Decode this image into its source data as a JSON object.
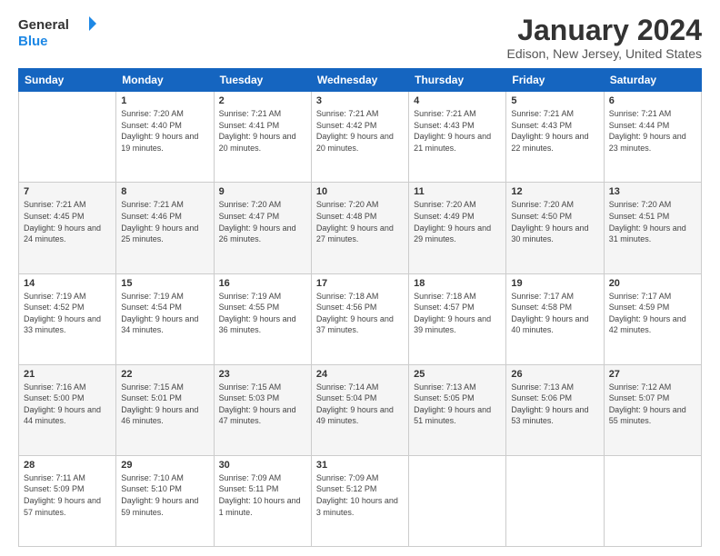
{
  "logo": {
    "line1": "General",
    "line2": "Blue"
  },
  "title": "January 2024",
  "location": "Edison, New Jersey, United States",
  "days_of_week": [
    "Sunday",
    "Monday",
    "Tuesday",
    "Wednesday",
    "Thursday",
    "Friday",
    "Saturday"
  ],
  "weeks": [
    [
      {
        "day": "",
        "sunrise": "",
        "sunset": "",
        "daylight": ""
      },
      {
        "day": "1",
        "sunrise": "Sunrise: 7:20 AM",
        "sunset": "Sunset: 4:40 PM",
        "daylight": "Daylight: 9 hours and 19 minutes."
      },
      {
        "day": "2",
        "sunrise": "Sunrise: 7:21 AM",
        "sunset": "Sunset: 4:41 PM",
        "daylight": "Daylight: 9 hours and 20 minutes."
      },
      {
        "day": "3",
        "sunrise": "Sunrise: 7:21 AM",
        "sunset": "Sunset: 4:42 PM",
        "daylight": "Daylight: 9 hours and 20 minutes."
      },
      {
        "day": "4",
        "sunrise": "Sunrise: 7:21 AM",
        "sunset": "Sunset: 4:43 PM",
        "daylight": "Daylight: 9 hours and 21 minutes."
      },
      {
        "day": "5",
        "sunrise": "Sunrise: 7:21 AM",
        "sunset": "Sunset: 4:43 PM",
        "daylight": "Daylight: 9 hours and 22 minutes."
      },
      {
        "day": "6",
        "sunrise": "Sunrise: 7:21 AM",
        "sunset": "Sunset: 4:44 PM",
        "daylight": "Daylight: 9 hours and 23 minutes."
      }
    ],
    [
      {
        "day": "7",
        "sunrise": "Sunrise: 7:21 AM",
        "sunset": "Sunset: 4:45 PM",
        "daylight": "Daylight: 9 hours and 24 minutes."
      },
      {
        "day": "8",
        "sunrise": "Sunrise: 7:21 AM",
        "sunset": "Sunset: 4:46 PM",
        "daylight": "Daylight: 9 hours and 25 minutes."
      },
      {
        "day": "9",
        "sunrise": "Sunrise: 7:20 AM",
        "sunset": "Sunset: 4:47 PM",
        "daylight": "Daylight: 9 hours and 26 minutes."
      },
      {
        "day": "10",
        "sunrise": "Sunrise: 7:20 AM",
        "sunset": "Sunset: 4:48 PM",
        "daylight": "Daylight: 9 hours and 27 minutes."
      },
      {
        "day": "11",
        "sunrise": "Sunrise: 7:20 AM",
        "sunset": "Sunset: 4:49 PM",
        "daylight": "Daylight: 9 hours and 29 minutes."
      },
      {
        "day": "12",
        "sunrise": "Sunrise: 7:20 AM",
        "sunset": "Sunset: 4:50 PM",
        "daylight": "Daylight: 9 hours and 30 minutes."
      },
      {
        "day": "13",
        "sunrise": "Sunrise: 7:20 AM",
        "sunset": "Sunset: 4:51 PM",
        "daylight": "Daylight: 9 hours and 31 minutes."
      }
    ],
    [
      {
        "day": "14",
        "sunrise": "Sunrise: 7:19 AM",
        "sunset": "Sunset: 4:52 PM",
        "daylight": "Daylight: 9 hours and 33 minutes."
      },
      {
        "day": "15",
        "sunrise": "Sunrise: 7:19 AM",
        "sunset": "Sunset: 4:54 PM",
        "daylight": "Daylight: 9 hours and 34 minutes."
      },
      {
        "day": "16",
        "sunrise": "Sunrise: 7:19 AM",
        "sunset": "Sunset: 4:55 PM",
        "daylight": "Daylight: 9 hours and 36 minutes."
      },
      {
        "day": "17",
        "sunrise": "Sunrise: 7:18 AM",
        "sunset": "Sunset: 4:56 PM",
        "daylight": "Daylight: 9 hours and 37 minutes."
      },
      {
        "day": "18",
        "sunrise": "Sunrise: 7:18 AM",
        "sunset": "Sunset: 4:57 PM",
        "daylight": "Daylight: 9 hours and 39 minutes."
      },
      {
        "day": "19",
        "sunrise": "Sunrise: 7:17 AM",
        "sunset": "Sunset: 4:58 PM",
        "daylight": "Daylight: 9 hours and 40 minutes."
      },
      {
        "day": "20",
        "sunrise": "Sunrise: 7:17 AM",
        "sunset": "Sunset: 4:59 PM",
        "daylight": "Daylight: 9 hours and 42 minutes."
      }
    ],
    [
      {
        "day": "21",
        "sunrise": "Sunrise: 7:16 AM",
        "sunset": "Sunset: 5:00 PM",
        "daylight": "Daylight: 9 hours and 44 minutes."
      },
      {
        "day": "22",
        "sunrise": "Sunrise: 7:15 AM",
        "sunset": "Sunset: 5:01 PM",
        "daylight": "Daylight: 9 hours and 46 minutes."
      },
      {
        "day": "23",
        "sunrise": "Sunrise: 7:15 AM",
        "sunset": "Sunset: 5:03 PM",
        "daylight": "Daylight: 9 hours and 47 minutes."
      },
      {
        "day": "24",
        "sunrise": "Sunrise: 7:14 AM",
        "sunset": "Sunset: 5:04 PM",
        "daylight": "Daylight: 9 hours and 49 minutes."
      },
      {
        "day": "25",
        "sunrise": "Sunrise: 7:13 AM",
        "sunset": "Sunset: 5:05 PM",
        "daylight": "Daylight: 9 hours and 51 minutes."
      },
      {
        "day": "26",
        "sunrise": "Sunrise: 7:13 AM",
        "sunset": "Sunset: 5:06 PM",
        "daylight": "Daylight: 9 hours and 53 minutes."
      },
      {
        "day": "27",
        "sunrise": "Sunrise: 7:12 AM",
        "sunset": "Sunset: 5:07 PM",
        "daylight": "Daylight: 9 hours and 55 minutes."
      }
    ],
    [
      {
        "day": "28",
        "sunrise": "Sunrise: 7:11 AM",
        "sunset": "Sunset: 5:09 PM",
        "daylight": "Daylight: 9 hours and 57 minutes."
      },
      {
        "day": "29",
        "sunrise": "Sunrise: 7:10 AM",
        "sunset": "Sunset: 5:10 PM",
        "daylight": "Daylight: 9 hours and 59 minutes."
      },
      {
        "day": "30",
        "sunrise": "Sunrise: 7:09 AM",
        "sunset": "Sunset: 5:11 PM",
        "daylight": "Daylight: 10 hours and 1 minute."
      },
      {
        "day": "31",
        "sunrise": "Sunrise: 7:09 AM",
        "sunset": "Sunset: 5:12 PM",
        "daylight": "Daylight: 10 hours and 3 minutes."
      },
      {
        "day": "",
        "sunrise": "",
        "sunset": "",
        "daylight": ""
      },
      {
        "day": "",
        "sunrise": "",
        "sunset": "",
        "daylight": ""
      },
      {
        "day": "",
        "sunrise": "",
        "sunset": "",
        "daylight": ""
      }
    ]
  ]
}
